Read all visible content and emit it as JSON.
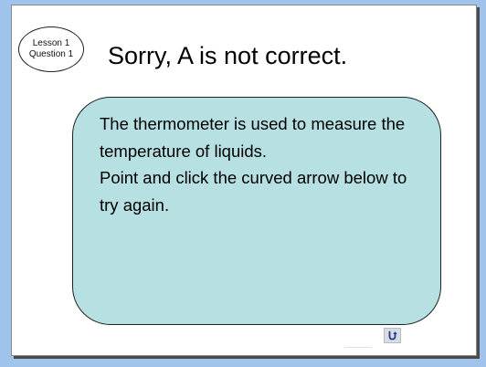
{
  "badge": {
    "line1": "Lesson 1",
    "line2": "Question 1"
  },
  "title": "Sorry, A is not correct.",
  "feedback": {
    "paragraph1": "The thermometer is used to measure the temperature of liquids.",
    "paragraph2": "Point and click the curved arrow below to try again."
  },
  "retry_button": {
    "icon": "curved-arrow-icon",
    "color": "#1f3a93"
  },
  "colors": {
    "background": "#9fc3ea",
    "box_fill": "#b7e0e3"
  }
}
